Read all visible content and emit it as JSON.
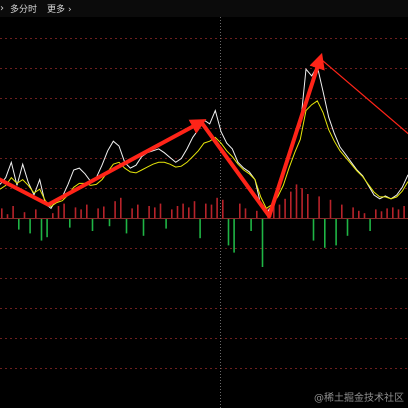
{
  "toolbar": {
    "prev_icon": "chevron-right-icon",
    "period_label": "多分时",
    "more_label": "更多",
    "more_chevron": "chevron-right-icon"
  },
  "watermark": {
    "text": "@稀土掘金技术社区"
  },
  "colors": {
    "background": "#000000",
    "grid_dashed": "#6e1f1f",
    "grid_solid": "#8a2a2a",
    "vertical_divider": "#6a6a6a",
    "price_line": "#f2f2f2",
    "avg_line": "#e6e60a",
    "bar_up": "#b8232a",
    "bar_down": "#1fb545",
    "trend_arrow": "#ff2418"
  },
  "chart_data": {
    "type": "line",
    "grid": true,
    "series": [
      {
        "values": [
          0.35,
          0.42,
          0.58,
          0.34,
          0.56,
          0.37,
          0.24,
          0.4,
          0.15,
          0.1,
          0.2,
          0.22,
          0.35,
          0.5,
          0.52,
          0.46,
          0.38,
          0.42,
          0.55,
          0.7,
          0.8,
          0.75,
          0.58,
          0.52,
          0.55,
          0.64,
          0.68,
          0.7,
          0.72,
          0.68,
          0.63,
          0.58,
          0.62,
          0.72,
          0.84,
          0.92,
          1.02,
          0.98,
          1.12,
          0.9,
          0.78,
          0.72,
          0.58,
          0.52,
          0.48,
          0.4,
          0.14,
          0.04,
          0.14,
          0.28,
          0.44,
          0.68,
          0.84,
          0.96,
          1.55,
          1.48,
          1.58,
          1.32,
          1.05,
          0.88,
          0.74,
          0.66,
          0.58,
          0.5,
          0.44,
          0.34,
          0.24,
          0.2,
          0.23,
          0.2,
          0.24,
          0.32,
          0.45
        ]
      },
      {
        "values": [
          0.3,
          0.34,
          0.42,
          0.36,
          0.4,
          0.34,
          0.26,
          0.3,
          0.18,
          0.12,
          0.16,
          0.18,
          0.24,
          0.32,
          0.36,
          0.36,
          0.34,
          0.35,
          0.4,
          0.48,
          0.56,
          0.58,
          0.52,
          0.48,
          0.47,
          0.5,
          0.53,
          0.56,
          0.58,
          0.58,
          0.56,
          0.53,
          0.54,
          0.58,
          0.64,
          0.7,
          0.78,
          0.8,
          0.84,
          0.78,
          0.7,
          0.64,
          0.56,
          0.5,
          0.46,
          0.4,
          0.22,
          0.1,
          0.14,
          0.22,
          0.34,
          0.52,
          0.68,
          0.82,
          1.12,
          1.18,
          1.22,
          1.1,
          0.92,
          0.8,
          0.7,
          0.63,
          0.56,
          0.49,
          0.43,
          0.35,
          0.27,
          0.22,
          0.22,
          0.2,
          0.22,
          0.28,
          0.38
        ]
      }
    ],
    "bars": [
      0.2,
      0.08,
      0.25,
      -0.22,
      0.12,
      -0.3,
      0.18,
      -0.45,
      -0.38,
      0.1,
      0.25,
      0.3,
      -0.18,
      0.22,
      0.18,
      0.28,
      -0.25,
      0.2,
      0.24,
      -0.15,
      0.35,
      0.42,
      -0.3,
      0.2,
      0.28,
      -0.35,
      0.25,
      0.22,
      0.3,
      -0.2,
      0.18,
      0.25,
      0.3,
      0.22,
      0.35,
      -0.4,
      0.3,
      0.28,
      0.42,
      0.38,
      -0.55,
      -0.7,
      0.3,
      0.2,
      -0.25,
      0.15,
      -1.0,
      0.2,
      0.35,
      0.28,
      0.4,
      0.55,
      0.7,
      0.62,
      0.5,
      -0.45,
      0.45,
      -0.6,
      0.38,
      -0.55,
      0.28,
      -0.35,
      0.22,
      0.15,
      0.1,
      -0.25,
      0.18,
      0.14,
      0.2,
      0.22,
      0.18,
      0.25,
      0.3
    ],
    "trend_arrows": [
      {
        "from": [
          0,
          0.4
        ],
        "to": [
          8.5,
          0.14
        ]
      },
      {
        "from": [
          8.5,
          0.14
        ],
        "to": [
          35.5,
          1.0
        ]
      },
      {
        "from": [
          35.5,
          1.0
        ],
        "to": [
          47.5,
          0.02
        ]
      },
      {
        "from": [
          47.5,
          0.02
        ],
        "to": [
          56.5,
          1.66
        ]
      },
      {
        "from": [
          56.5,
          1.66
        ],
        "to": [
          72,
          0.88
        ]
      }
    ]
  }
}
